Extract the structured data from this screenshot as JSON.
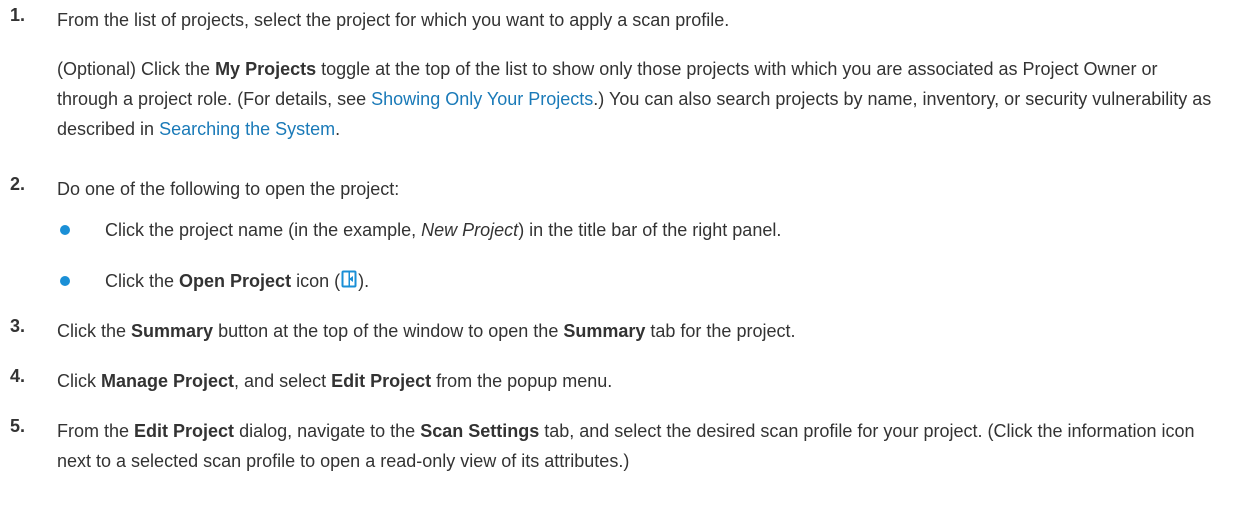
{
  "steps": [
    {
      "num": "1.",
      "text": "From the list of projects, select the project for which you want to apply a scan profile.",
      "optional": {
        "t1": "(Optional) Click the ",
        "b1": "My Projects",
        "t2": " toggle at the top of the list to show only those projects with which you are associated as Project Owner or through a project role. (For details, see ",
        "link1": "Showing Only Your Projects",
        "t3": ".) You can also search projects by name, inventory, or security vulnerability as described in ",
        "link2": "Searching the System",
        "t4": "."
      }
    },
    {
      "num": "2.",
      "text": "Do one of the following to open the project:",
      "bullets": [
        {
          "t1": "Click the project name (in the example, ",
          "i1": "New Project",
          "t2": ") in the title bar of the right panel."
        },
        {
          "t1": "Click the ",
          "b1": "Open Project",
          "t2": " icon (",
          "t3": ")."
        }
      ]
    },
    {
      "num": "3.",
      "t1": "Click the ",
      "b1": "Summary",
      "t2": " button at the top of the window to open the ",
      "b2": "Summary",
      "t3": " tab for the project."
    },
    {
      "num": "4.",
      "t1": "Click ",
      "b1": "Manage Project",
      "t2": ", and select ",
      "b2": "Edit Project",
      "t3": " from the popup menu."
    },
    {
      "num": "5.",
      "t1": "From the ",
      "b1": "Edit Project",
      "t2": " dialog, navigate to the ",
      "b2": "Scan Settings",
      "t3": " tab, and select the desired scan profile for your project. (Click the information icon next to a selected scan profile to open a read-only view of its attributes.)"
    }
  ],
  "icons": {
    "open_project": "open-project-icon"
  },
  "colors": {
    "link": "#1a7ab8",
    "bullet": "#1a8fd6",
    "text": "#333333"
  }
}
